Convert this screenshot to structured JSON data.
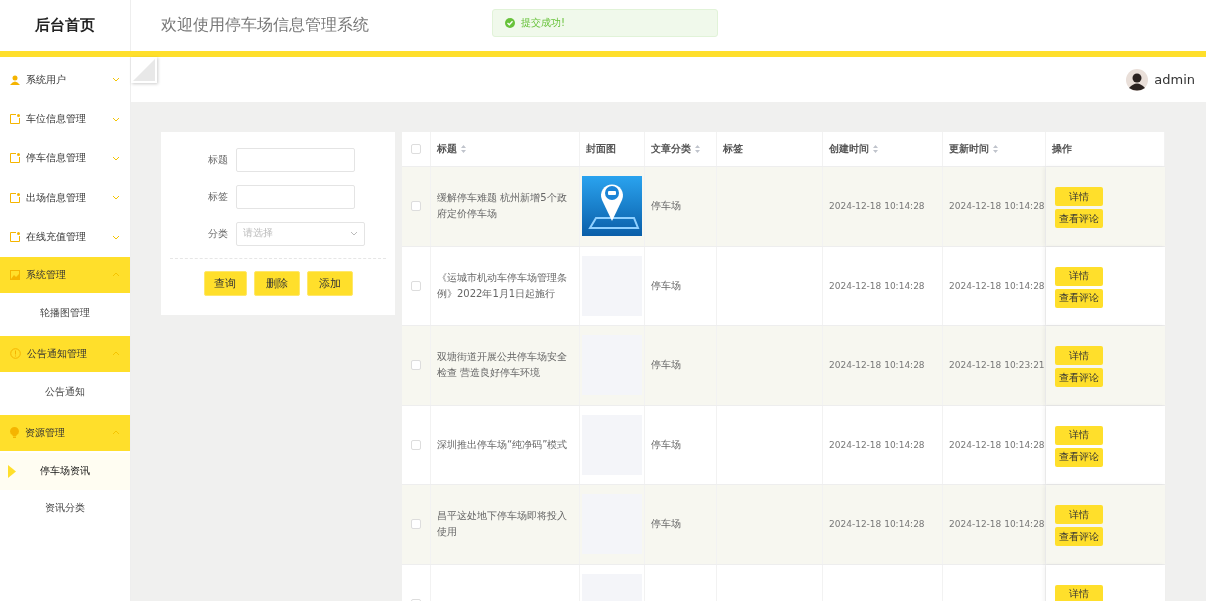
{
  "brand": "后台首页",
  "header": {
    "title": "欢迎使用停车场信息管理系统"
  },
  "toast": {
    "message": "提交成功!"
  },
  "user": {
    "name": "admin"
  },
  "sidebar": {
    "items": [
      {
        "label": "系统用户",
        "expanded": false
      },
      {
        "label": "车位信息管理",
        "expanded": false
      },
      {
        "label": "停车信息管理",
        "expanded": false
      },
      {
        "label": "出场信息管理",
        "expanded": false
      },
      {
        "label": "在线充值管理",
        "expanded": false
      },
      {
        "label": "系统管理",
        "expanded": true,
        "children": [
          {
            "label": "轮播图管理",
            "selected": false
          }
        ]
      },
      {
        "label": "公告通知管理",
        "expanded": true,
        "children": [
          {
            "label": "公告通知",
            "selected": false
          }
        ]
      },
      {
        "label": "资源管理",
        "expanded": true,
        "children": [
          {
            "label": "停车场资讯",
            "selected": true
          },
          {
            "label": "资讯分类",
            "selected": false
          }
        ]
      }
    ]
  },
  "search_form": {
    "fields": [
      {
        "kind": "text",
        "label": "标题"
      },
      {
        "kind": "text",
        "label": "标签"
      },
      {
        "kind": "select",
        "label": "分类",
        "placeholder": "请选择"
      }
    ],
    "buttons": [
      "查询",
      "删除",
      "添加"
    ]
  },
  "table": {
    "select_all": {
      "checked": false
    },
    "columns": [
      {
        "label": "标题",
        "sortable": true
      },
      {
        "label": "封面图",
        "sortable": false
      },
      {
        "label": "文章分类",
        "sortable": true
      },
      {
        "label": "标签",
        "sortable": false
      },
      {
        "label": "创建时间",
        "sortable": true
      },
      {
        "label": "更新时间",
        "sortable": true
      },
      {
        "label": "操作",
        "sortable": false
      }
    ],
    "rows": [
      {
        "checked": false,
        "title": "缓解停车难题 杭州新增5个政府定价停车场",
        "cover": {
          "kind": "picture"
        },
        "category": "停车场",
        "created": "2024-12-18 10:14:28",
        "updated": "2024-12-18 10:14:28",
        "actions": [
          "详情",
          "查看评论"
        ]
      },
      {
        "checked": false,
        "title": "《运城市机动车停车场管理条例》2022年1月1日起施行",
        "cover": {
          "kind": "blank"
        },
        "category": "停车场",
        "created": "2024-12-18 10:14:28",
        "updated": "2024-12-18 10:14:28",
        "actions": [
          "详情",
          "查看评论"
        ]
      },
      {
        "checked": false,
        "title": "双塘街道开展公共停车场安全检查 营造良好停车环境",
        "cover": {
          "kind": "blank"
        },
        "category": "停车场",
        "created": "2024-12-18 10:14:28",
        "updated": "2024-12-18 10:23:21",
        "actions": [
          "详情",
          "查看评论"
        ]
      },
      {
        "checked": false,
        "title": "深圳推出停车场“纯净码”模式",
        "cover": {
          "kind": "blank"
        },
        "category": "停车场",
        "created": "2024-12-18 10:14:28",
        "updated": "2024-12-18 10:14:28",
        "actions": [
          "详情",
          "查看评论"
        ]
      },
      {
        "checked": false,
        "title": "昌平这处地下停车场即将投入使用",
        "cover": {
          "kind": "blank"
        },
        "category": "停车场",
        "created": "2024-12-18 10:14:28",
        "updated": "2024-12-18 10:14:28",
        "actions": [
          "详情",
          "查看评论"
        ]
      },
      {
        "checked": false,
        "cover": {
          "kind": "blank"
        },
        "actions": [
          "详情"
        ]
      }
    ]
  }
}
